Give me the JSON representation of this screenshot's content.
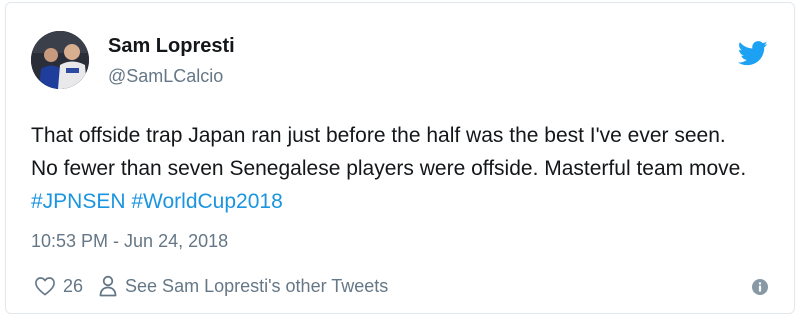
{
  "tweet": {
    "author": {
      "name": "Sam Lopresti",
      "handle": "@SamLCalcio"
    },
    "text_plain": "That offside trap Japan ran just before the half was the best I've ever seen. No fewer than seven Senegalese players were offside. Masterful team move.",
    "hashtags": [
      "#JPNSEN",
      "#WorldCup2018"
    ],
    "timestamp": "10:53 PM - Jun 24, 2018",
    "like_count": "26",
    "other_tweets_label": "See Sam Lopresti's other Tweets"
  },
  "icons": {
    "brand": "twitter-bird-icon",
    "like": "heart-icon",
    "profile": "person-icon",
    "info": "info-icon"
  },
  "colors": {
    "link": "#1b95e0",
    "twitter_blue": "#1da1f2",
    "muted": "#657786",
    "text": "#14171a",
    "border": "#e1e8ed"
  }
}
